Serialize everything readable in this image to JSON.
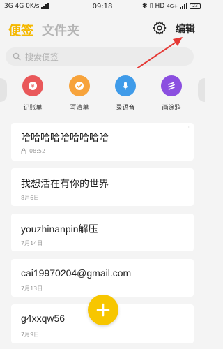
{
  "status_bar": {
    "left_text": "3G 4G 0K/s",
    "time": "09:18",
    "right_text": "HD",
    "network_badge": "4G+",
    "battery": "23"
  },
  "header": {
    "tab_notes": "便签",
    "tab_folders": "文件夹",
    "edit_label": "编辑"
  },
  "search": {
    "placeholder": "搜索便签"
  },
  "quick_actions": [
    {
      "label": "记账单",
      "icon": "ledger-icon",
      "color": "#e9585a"
    },
    {
      "label": "写清单",
      "icon": "checklist-icon",
      "color": "#f7a33b"
    },
    {
      "label": "录语音",
      "icon": "microphone-icon",
      "color": "#3f9be9"
    },
    {
      "label": "画涂鸦",
      "icon": "doodle-icon",
      "color": "#8b4fe0"
    }
  ],
  "notes": [
    {
      "title": "哈哈哈哈哈哈哈哈哈",
      "date": "08:52",
      "locked": true
    },
    {
      "title": "我想活在有你的世界",
      "date": "8月6日",
      "locked": false
    },
    {
      "title": "youzhinanpin解压",
      "date": "7月14日",
      "locked": false
    },
    {
      "title": "cai19970204@gmail.com",
      "date": "7月13日",
      "locked": false
    },
    {
      "title": "g4xxqw56",
      "date": "7月9日",
      "locked": false
    }
  ],
  "colors": {
    "accent": "#f5b800",
    "fab": "#f7c600",
    "arrow": "#e53935",
    "background": "#f4f4f4"
  }
}
